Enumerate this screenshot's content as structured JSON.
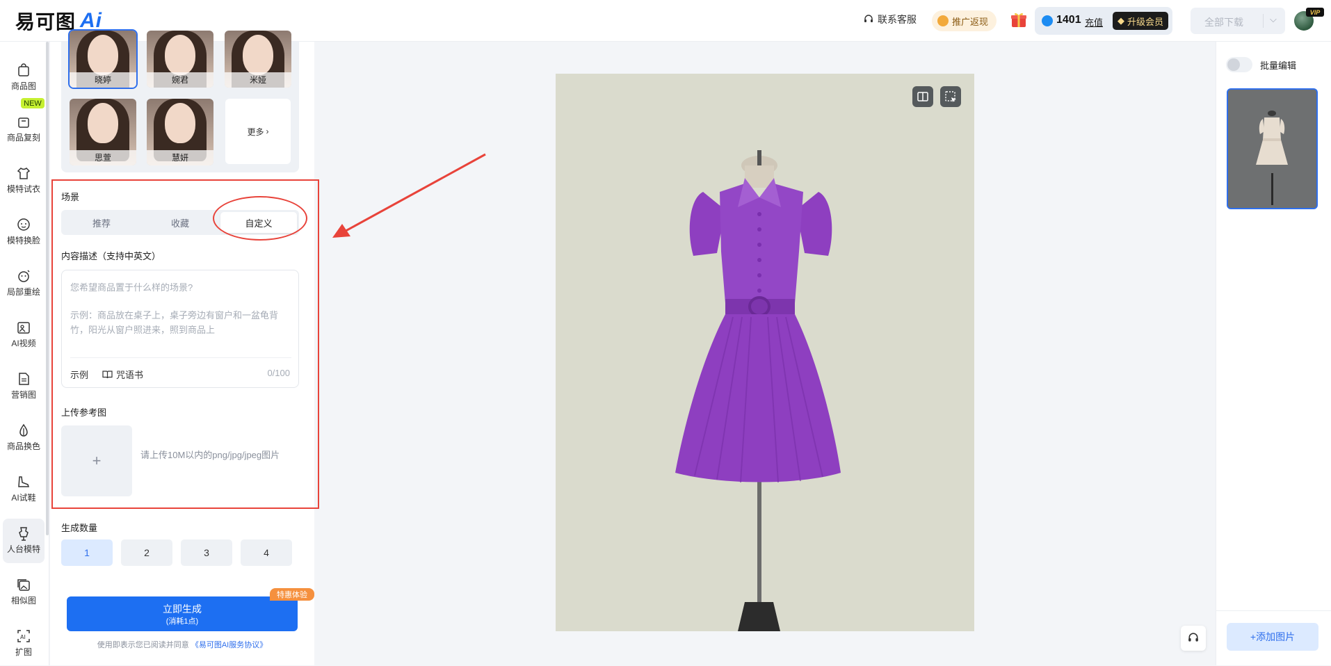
{
  "brand": {
    "logo_text": "易可图",
    "logo_ai": "Ai"
  },
  "header": {
    "support_label": "联系客服",
    "promo_label": "推广返现",
    "credits": "1401",
    "recharge_label": "充值",
    "upgrade_label": "升级会员",
    "download_label": "全部下载",
    "vip_badge": "VIP"
  },
  "nav": {
    "new_badge": "NEW",
    "items": [
      {
        "label": "商品图",
        "icon": "bag-icon"
      },
      {
        "label": "商品复刻",
        "icon": "copy-bag-icon"
      },
      {
        "label": "模特试衣",
        "icon": "shirt-icon"
      },
      {
        "label": "模特换脸",
        "icon": "face-icon"
      },
      {
        "label": "局部重绘",
        "icon": "face-edit-icon"
      },
      {
        "label": "AI视频",
        "icon": "video-icon"
      },
      {
        "label": "营销图",
        "icon": "document-icon"
      },
      {
        "label": "商品换色",
        "icon": "droplet-icon"
      },
      {
        "label": "AI试鞋",
        "icon": "shoe-icon"
      },
      {
        "label": "人台模特",
        "icon": "mannequin-icon",
        "active": true
      },
      {
        "label": "相似图",
        "icon": "images-icon"
      },
      {
        "label": "扩图",
        "icon": "expand-icon"
      }
    ]
  },
  "models": {
    "items": [
      {
        "name": "晓婷",
        "selected": true
      },
      {
        "name": "婉君"
      },
      {
        "name": "米娅"
      },
      {
        "name": "思萱"
      },
      {
        "name": "慧妍"
      }
    ],
    "more_label": "更多"
  },
  "scene": {
    "label": "场景",
    "tabs": [
      {
        "label": "推荐"
      },
      {
        "label": "收藏"
      },
      {
        "label": "自定义",
        "active": true
      }
    ],
    "desc_label": "内容描述（支持中英文）",
    "placeholder": "您希望商品置于什么样的场景?",
    "example_text": "示例：商品放在桌子上，桌子旁边有窗户和一盆龟背竹，阳光从窗户照进来，照到商品上",
    "example_button": "示例",
    "spellbook_button": "咒语书",
    "char_count": "0/100"
  },
  "reference": {
    "label": "上传参考图",
    "plus": "+",
    "tip": "请上传10M以内的png/jpg/jpeg图片"
  },
  "quantity": {
    "label": "生成数量",
    "options": [
      "1",
      "2",
      "3",
      "4"
    ],
    "selected": "1"
  },
  "generate": {
    "label": "立即生成",
    "cost": "(消耗1点)",
    "deal_badge": "特惠体验",
    "agree_prefix": "使用即表示您已阅读并同意",
    "agree_link": "《易可图AI服务协议》"
  },
  "right": {
    "batch_label": "批量编辑",
    "add_label": "+添加图片"
  },
  "colors": {
    "accent": "#1d6ff2",
    "highlight": "#e8433a",
    "dress": "#8e3fc0"
  }
}
